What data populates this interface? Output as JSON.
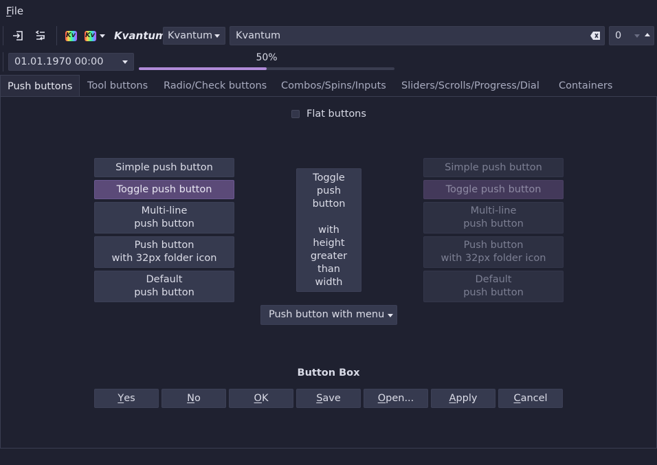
{
  "menubar": {
    "file_prefix": "F",
    "file_rest": "ile"
  },
  "toolbar": {
    "kvantum_label": "Kvantum",
    "kv_icon_text": "Kv",
    "style_combo_value": "Kvantum",
    "line_edit_value": "Kvantum",
    "spin_value": "0",
    "datetime_value": "01.01.1970 00:00",
    "progress_text": "50%",
    "progress_value": 0.5
  },
  "tabs": [
    "Push buttons",
    "Tool buttons",
    "Radio/Check buttons",
    "Combos/Spins/Inputs",
    "Sliders/Scrolls/Progress/Dial",
    "Containers"
  ],
  "panel": {
    "flat_label": "Flat buttons",
    "left_buttons": {
      "simple": "Simple push button",
      "toggle": "Toggle push button",
      "multiline": "Multi-line\npush button",
      "icon": "Push button\nwith 32px folder icon",
      "default": "Default\npush button"
    },
    "tall_button": "Toggle\npush\nbutton\n\nwith\nheight\ngreater\nthan\nwidth",
    "menu_button": "Push button with menu",
    "right_buttons": {
      "simple": "Simple push button",
      "toggle": "Toggle push button",
      "multiline": "Multi-line\npush button",
      "icon": "Push button\nwith 32px folder icon",
      "default": "Default\npush button"
    },
    "button_box_title": "Button Box",
    "button_box": [
      {
        "u": "Y",
        "rest": "es"
      },
      {
        "u": "N",
        "rest": "o"
      },
      {
        "u": "O",
        "rest": "K"
      },
      {
        "u": "S",
        "rest": "ave"
      },
      {
        "u": "O",
        "rest": "pen..."
      },
      {
        "u": "A",
        "rest": "pply"
      },
      {
        "u": "C",
        "rest": "ancel"
      }
    ]
  },
  "colors": {
    "accent": "#b08ad8",
    "toggled": "#5b4a78",
    "background": "#1f2130"
  }
}
